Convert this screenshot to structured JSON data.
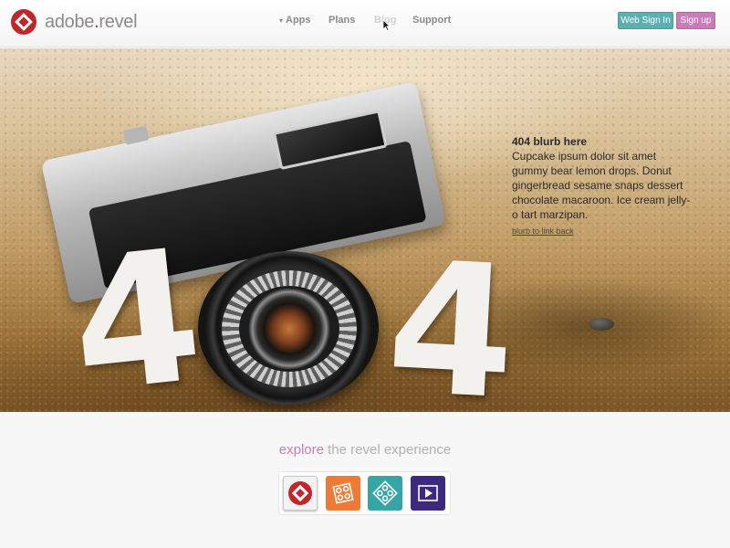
{
  "header": {
    "logo": {
      "brand": "adobe",
      "dot": ".",
      "product": "revel"
    },
    "nav": [
      {
        "label": "Apps",
        "has_caret": true
      },
      {
        "label": "Plans"
      },
      {
        "label": "Blog",
        "state": "hover"
      },
      {
        "label": "Support"
      }
    ],
    "web_sign_in_label": "Web Sign In",
    "sign_up_label": "Sign up"
  },
  "hero": {
    "big_text_left": "4",
    "big_text_right": "4",
    "blurb_title": "404 blurb here",
    "blurb_body": "Cupcake ipsum dolor sit amet gummy bear lemon drops. Donut gingerbread sesame snaps dessert chocolate macaroon. Ice cream jelly-o tart marzipan.",
    "blurb_link": "blurb to link back"
  },
  "explore": {
    "highlight": "explore",
    "rest": " the revel experience",
    "apps": [
      {
        "name": "revel-app-icon",
        "color": "#f2f2f2"
      },
      {
        "name": "photo-collage-app-icon",
        "color": "#ef7a36"
      },
      {
        "name": "photo-album-app-icon",
        "color": "#35a6a3"
      },
      {
        "name": "video-app-icon",
        "color": "#3c2a7e"
      }
    ]
  },
  "colors": {
    "accent_teal": "#5bb1b2",
    "accent_pink": "#c97cb6",
    "brand_red": "#c0272d"
  }
}
